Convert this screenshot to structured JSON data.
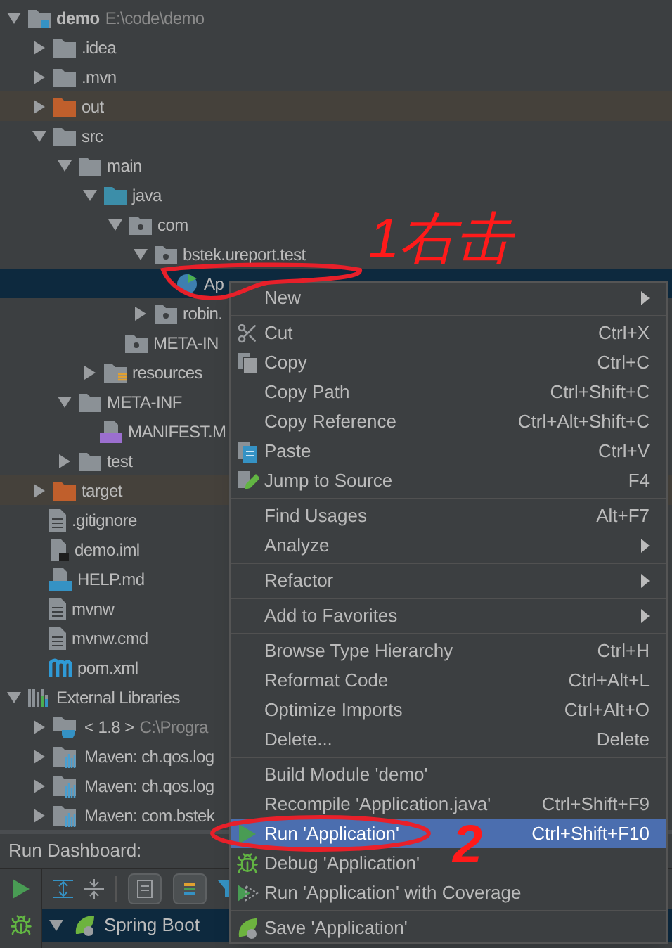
{
  "project_tree": [
    {
      "label": "demo",
      "hint": "E:\\code\\demo",
      "kind": "module",
      "expanded": true,
      "children": [
        {
          "label": ".idea",
          "kind": "folder",
          "expanded": false
        },
        {
          "label": ".mvn",
          "kind": "folder",
          "expanded": false
        },
        {
          "label": "out",
          "kind": "folder-excluded",
          "expanded": false,
          "highlighted": true
        },
        {
          "label": "src",
          "kind": "folder",
          "expanded": true,
          "children": [
            {
              "label": "main",
              "kind": "folder",
              "expanded": true,
              "children": [
                {
                  "label": "java",
                  "kind": "folder-source",
                  "expanded": true,
                  "children": [
                    {
                      "label": "com",
                      "kind": "package",
                      "expanded": true,
                      "children": [
                        {
                          "label": "bstek.ureport.test",
                          "kind": "package",
                          "expanded": true,
                          "children": [
                            {
                              "label": "Ap",
                              "kind": "java-class",
                              "selected": true
                            }
                          ]
                        },
                        {
                          "label": "robin.",
                          "kind": "package",
                          "expanded": false
                        }
                      ]
                    },
                    {
                      "label": "META-IN",
                      "kind": "package"
                    }
                  ]
                },
                {
                  "label": "resources",
                  "kind": "folder-resources",
                  "expanded": false
                }
              ]
            },
            {
              "label": "META-INF",
              "kind": "folder",
              "expanded": true,
              "children": [
                {
                  "label": "MANIFEST.M",
                  "kind": "manifest"
                }
              ]
            },
            {
              "label": "test",
              "kind": "folder",
              "expanded": false
            }
          ]
        },
        {
          "label": "target",
          "kind": "folder-excluded",
          "expanded": false,
          "highlighted": true
        },
        {
          "label": ".gitignore",
          "kind": "file"
        },
        {
          "label": "demo.iml",
          "kind": "iml"
        },
        {
          "label": "HELP.md",
          "kind": "markdown"
        },
        {
          "label": "mvnw",
          "kind": "file"
        },
        {
          "label": "mvnw.cmd",
          "kind": "file"
        },
        {
          "label": "pom.xml",
          "kind": "maven"
        }
      ]
    },
    {
      "label": "External Libraries",
      "kind": "libraries",
      "expanded": true,
      "children": [
        {
          "label": "< 1.8 >",
          "hint": "C:\\Progra",
          "kind": "jdk",
          "expanded": false
        },
        {
          "label": "Maven: ch.qos.log",
          "kind": "library",
          "expanded": false
        },
        {
          "label": "Maven: ch.qos.log",
          "kind": "library",
          "expanded": false
        },
        {
          "label": "Maven: com.bstek",
          "kind": "library",
          "expanded": false
        }
      ]
    }
  ],
  "run_dashboard": {
    "title": "Run Dashboard:",
    "rows": [
      {
        "label": "Spring Boot",
        "expanded": true,
        "selected": true
      }
    ]
  },
  "context_menu": [
    {
      "kind": "item",
      "label": "New",
      "submenu": true,
      "selected": false
    },
    {
      "kind": "separator"
    },
    {
      "kind": "cut",
      "label": "Cut",
      "shortcut": "Ctrl+X",
      "selected": false
    },
    {
      "kind": "copy",
      "label": "Copy",
      "shortcut": "Ctrl+C",
      "selected": false
    },
    {
      "kind": "item",
      "label": "Copy Path",
      "shortcut": "Ctrl+Shift+C",
      "selected": false
    },
    {
      "kind": "item",
      "label": "Copy Reference",
      "shortcut": "Ctrl+Alt+Shift+C",
      "selected": false
    },
    {
      "kind": "paste",
      "label": "Paste",
      "shortcut": "Ctrl+V",
      "selected": false
    },
    {
      "kind": "jump",
      "label": "Jump to Source",
      "shortcut": "F4",
      "selected": false
    },
    {
      "kind": "separator"
    },
    {
      "kind": "item",
      "label": "Find Usages",
      "shortcut": "Alt+F7",
      "selected": false
    },
    {
      "kind": "item",
      "label": "Analyze",
      "submenu": true,
      "selected": false
    },
    {
      "kind": "separator"
    },
    {
      "kind": "item",
      "label": "Refactor",
      "submenu": true,
      "selected": false
    },
    {
      "kind": "separator"
    },
    {
      "kind": "item",
      "label": "Add to Favorites",
      "submenu": true,
      "selected": false
    },
    {
      "kind": "separator"
    },
    {
      "kind": "item",
      "label": "Browse Type Hierarchy",
      "shortcut": "Ctrl+H",
      "selected": false
    },
    {
      "kind": "item",
      "label": "Reformat Code",
      "shortcut": "Ctrl+Alt+L",
      "selected": false
    },
    {
      "kind": "item",
      "label": "Optimize Imports",
      "shortcut": "Ctrl+Alt+O",
      "selected": false
    },
    {
      "kind": "item",
      "label": "Delete...",
      "shortcut": "Delete",
      "selected": false
    },
    {
      "kind": "separator"
    },
    {
      "kind": "item",
      "label": "Build Module 'demo'",
      "selected": false
    },
    {
      "kind": "item",
      "label": "Recompile 'Application.java'",
      "shortcut": "Ctrl+Shift+F9",
      "selected": false
    },
    {
      "kind": "run",
      "label": "Run 'Application'",
      "shortcut": "Ctrl+Shift+F10",
      "selected": true
    },
    {
      "kind": "debug",
      "label": "Debug 'Application'",
      "selected": false
    },
    {
      "kind": "coverage",
      "label": "Run 'Application' with Coverage",
      "selected": false
    },
    {
      "kind": "separator"
    },
    {
      "kind": "save",
      "label": "Save 'Application'",
      "selected": false
    }
  ],
  "annotations": [
    {
      "text": "1右击"
    },
    {
      "text": "2"
    }
  ]
}
